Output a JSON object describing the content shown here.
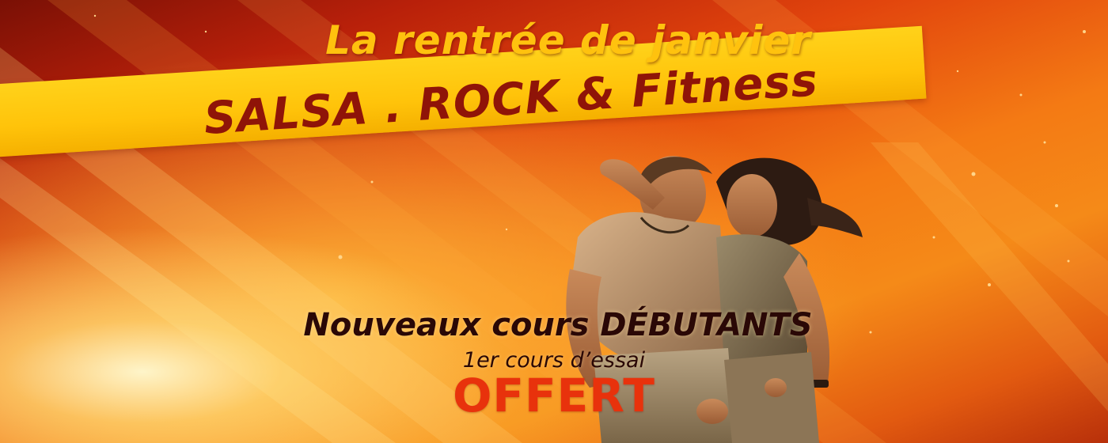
{
  "banner": {
    "headline": "La rentrée de janvier",
    "dance_styles": "SALSA . ROCK  &  Fitness",
    "subheadline": "Nouveaux cours DÉBUTANTS",
    "trial_line": "1er cours d’essai",
    "offer": "OFFERT",
    "image_subject": "dancing-couple-photo"
  },
  "colors": {
    "headline": "#ffc20e",
    "ribbon": "#ffc30a",
    "ribbon_text": "#8f1408",
    "subheadline": "#2a0806",
    "offer": "#e8320c"
  }
}
